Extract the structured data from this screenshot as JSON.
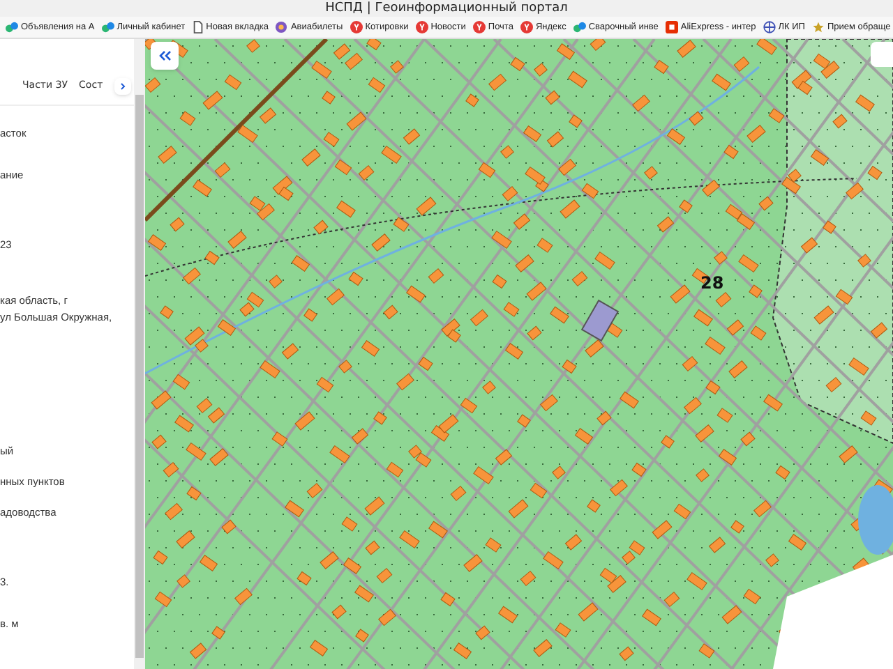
{
  "window": {
    "title": "НСПД | Геоинформационный портал"
  },
  "bookmarks": [
    {
      "label": "Объявления на А",
      "kind": "leaf"
    },
    {
      "label": "Личный кабинет",
      "kind": "leaf"
    },
    {
      "label": "Новая вкладка",
      "kind": "page"
    },
    {
      "label": "Авиабилеты",
      "kind": "circle"
    },
    {
      "label": "Котировки",
      "kind": "y"
    },
    {
      "label": "Новости",
      "kind": "y"
    },
    {
      "label": "Почта",
      "kind": "y"
    },
    {
      "label": "Яндекс",
      "kind": "y"
    },
    {
      "label": "Сварочный инве",
      "kind": "leaf"
    },
    {
      "label": "AliExpress - интер",
      "kind": "ali"
    },
    {
      "label": "ЛК ИП",
      "kind": "globe"
    },
    {
      "label": "Прием обраще",
      "kind": "star"
    }
  ],
  "panel": {
    "tabs": [
      {
        "label": "Части ЗУ",
        "selected": false
      },
      {
        "label": "Сост",
        "selected": false
      }
    ],
    "fields": [
      "асток",
      "ание",
      "23",
      "кая область, г\nул Большая Окружная,",
      "ый",
      "нных пунктов",
      "адоводства",
      "3.",
      "в. м"
    ]
  },
  "map": {
    "label": "28"
  }
}
